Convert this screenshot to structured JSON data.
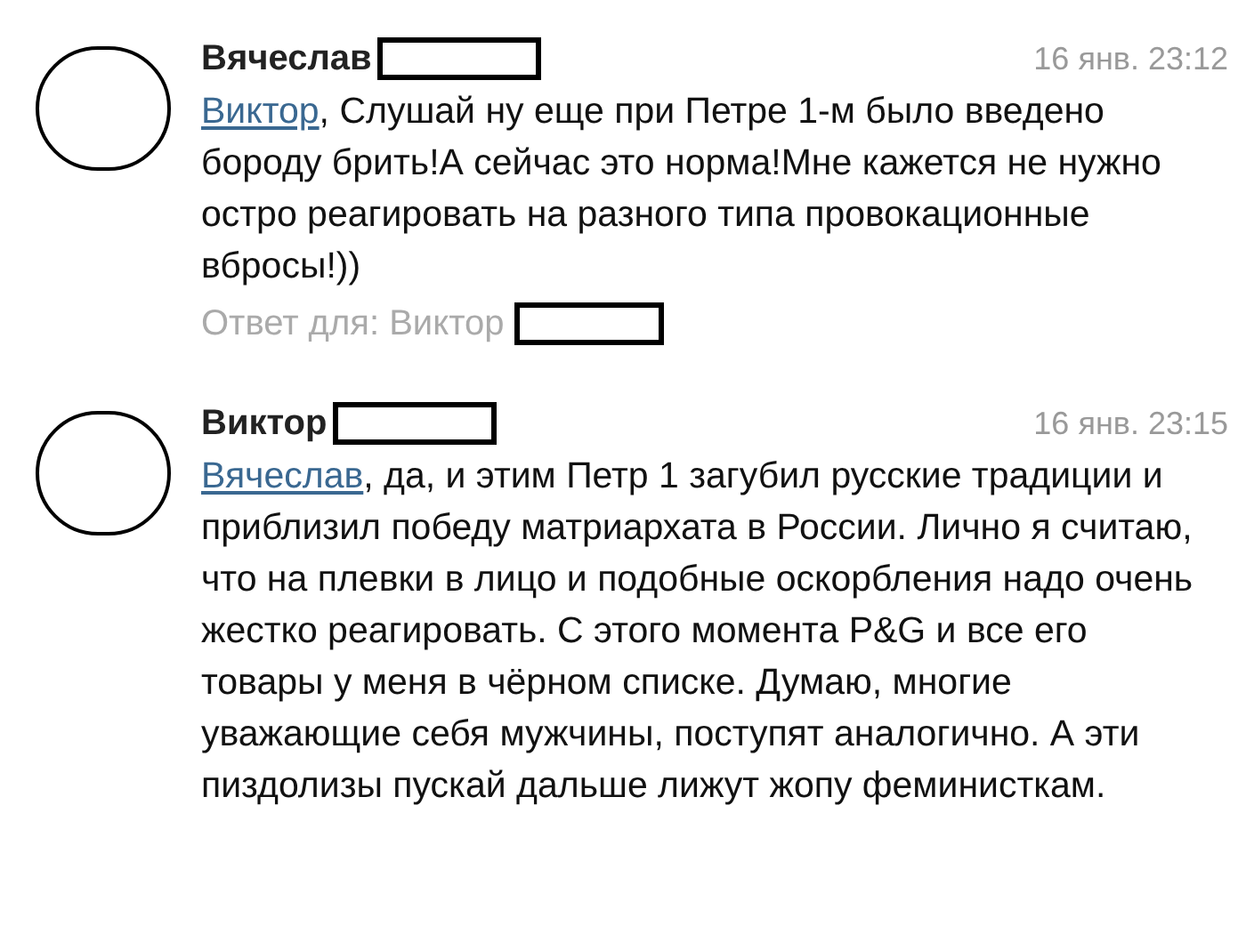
{
  "comments": [
    {
      "author": "Вячеслав",
      "time": "16 янв. 23:12",
      "mention": "Виктор",
      "text": ", Слушай ну еще при Петре 1-м было введено бороду брить!А сейчас это норма!Мне кажется не нужно остро реагировать на разного типа провокационные вбросы!))",
      "reply_to": "Ответ для: Виктор"
    },
    {
      "author": "Виктор",
      "time": "16 янв. 23:15",
      "mention": "Вячеслав",
      "text": ", да, и этим Петр 1 загубил русские традиции и приблизил победу матриархата в России. Лично я считаю, что на плевки в лицо и подобные оскорбления надо очень жестко реагировать. С этого момента P&G и все его товары у меня в чёрном списке. Думаю, многие уважающие себя мужчины, поступят аналогично. А эти пиздолизы пускай дальше лижут жопу феминисткам."
    }
  ]
}
